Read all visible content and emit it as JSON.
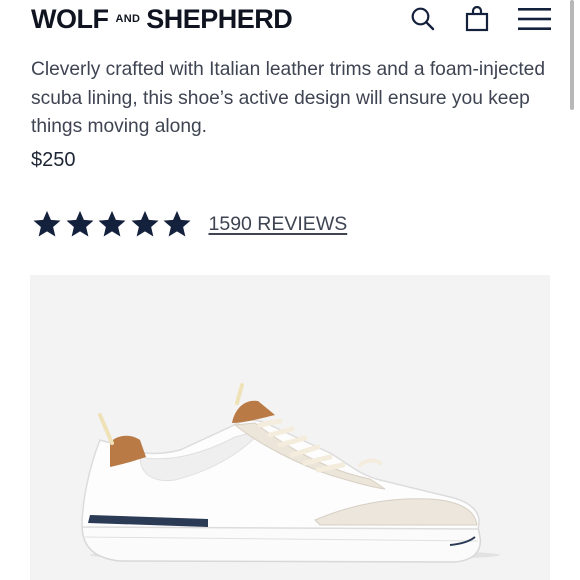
{
  "header": {
    "logo_left": "WOLF",
    "logo_mid": "AND",
    "logo_right": "SHEPHERD",
    "icons": [
      "search-icon",
      "shopping-bag-icon",
      "hamburger-menu-icon"
    ]
  },
  "product": {
    "description": "Cleverly crafted with Italian leather trims and a foam-injected scuba lining, this shoe’s active design will ensure you keep things moving along.",
    "price": "$250"
  },
  "rating": {
    "stars": 5,
    "reviews_label": "1590 REVIEWS"
  },
  "image": {
    "subject": "white sneaker with tan leather trim",
    "background_color": "#f3f3f3"
  },
  "colors": {
    "brand_text": "#0f1420",
    "body_text": "#3e4452",
    "star": "#14213d"
  }
}
